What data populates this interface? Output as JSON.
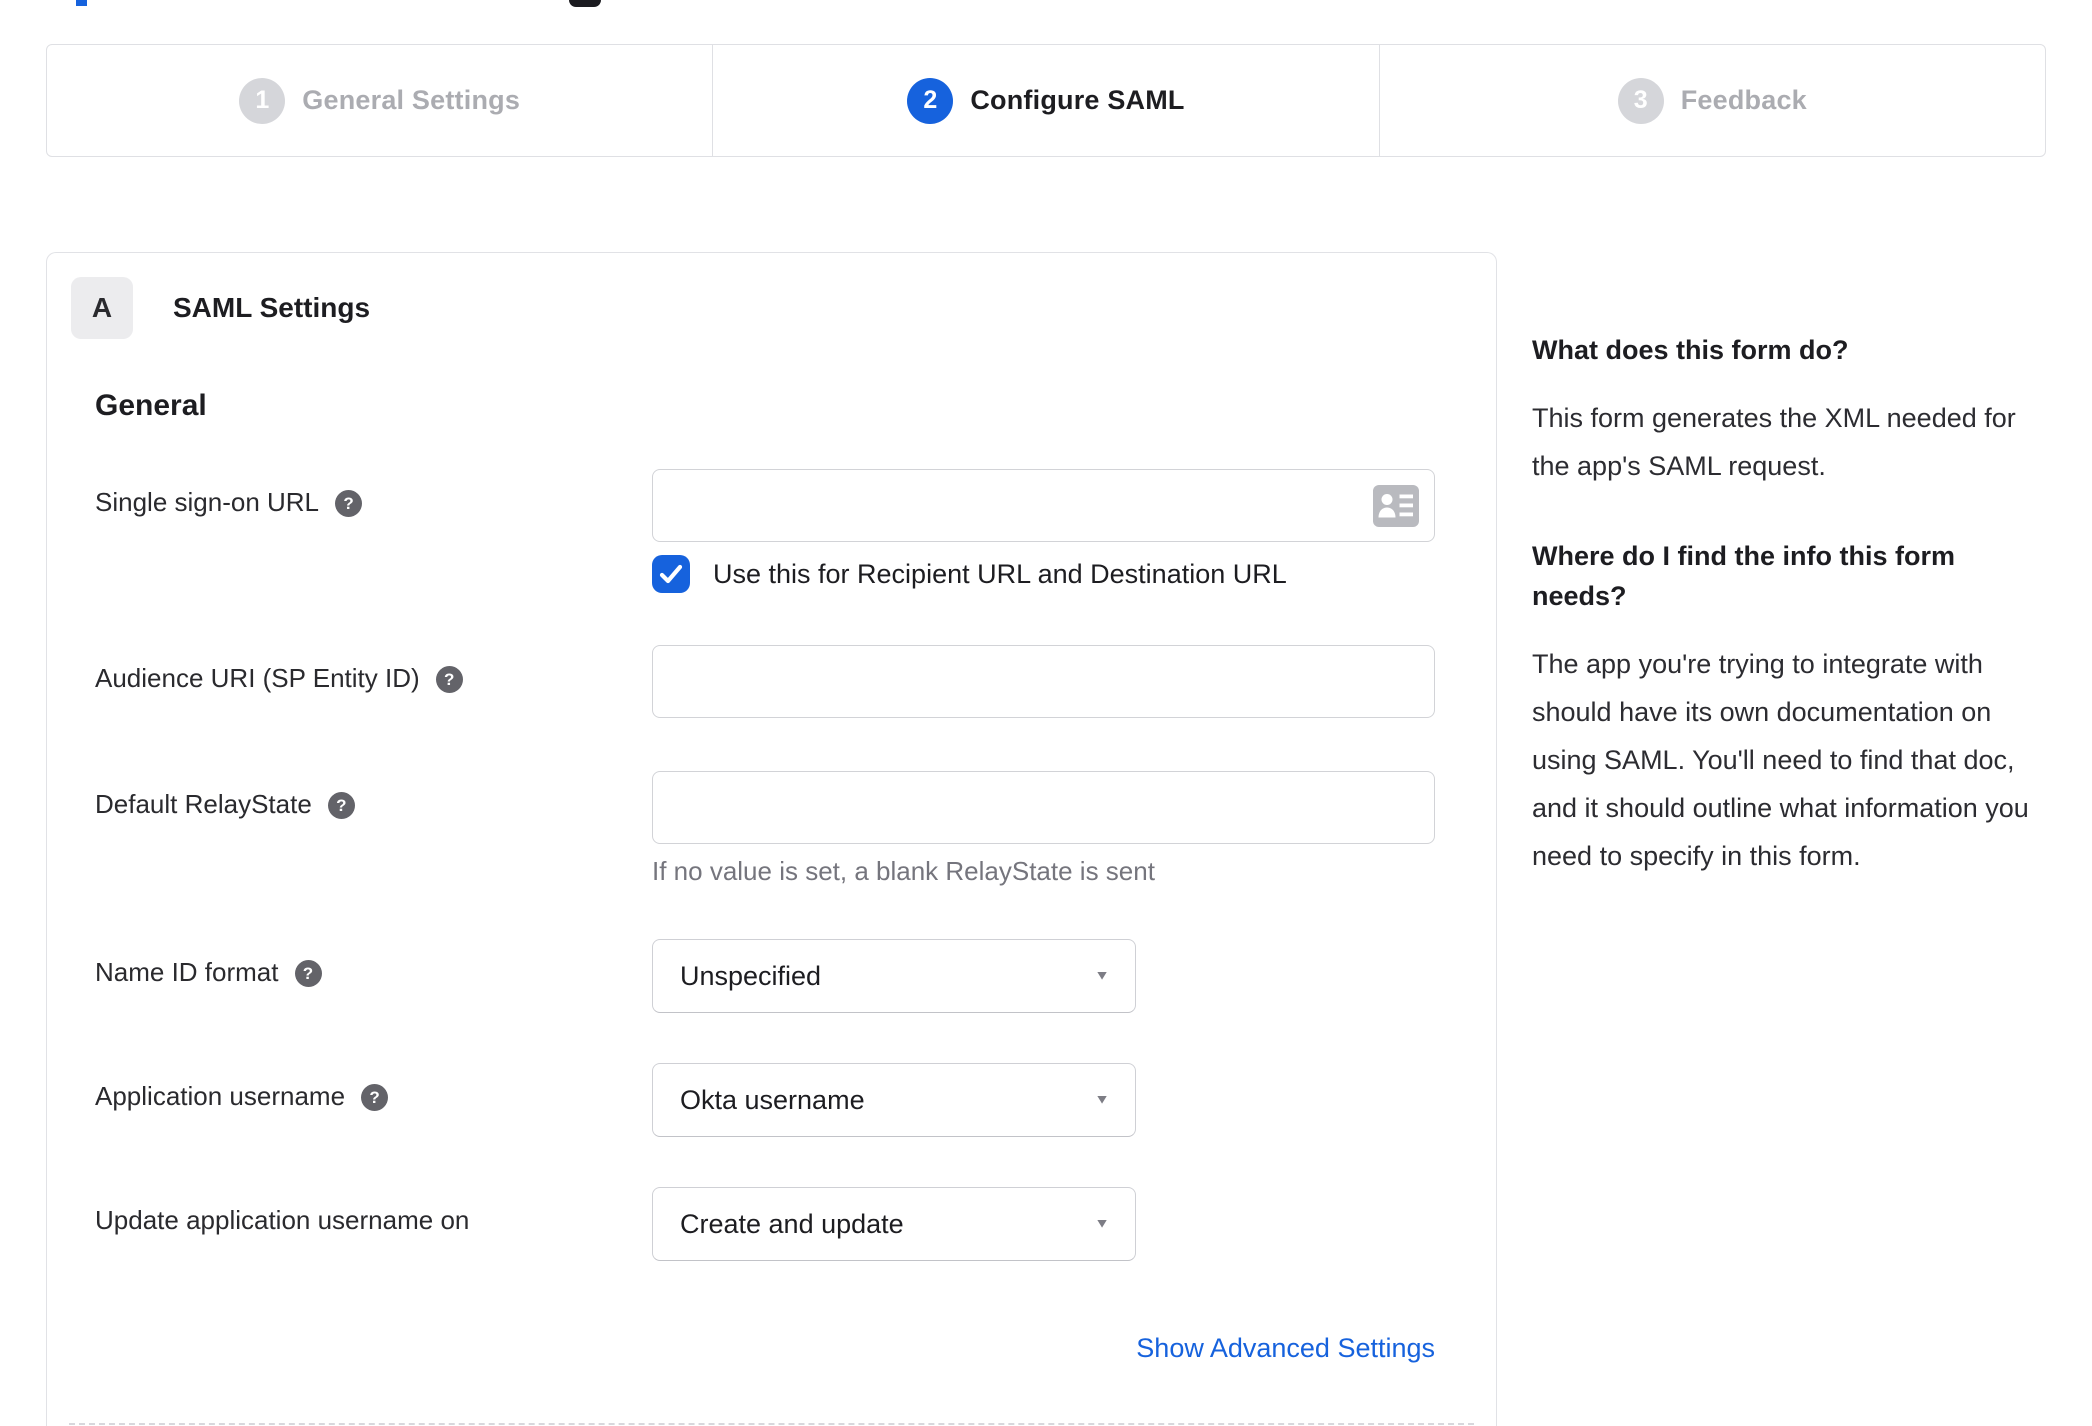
{
  "colors": {
    "accent_blue": "#1662dd",
    "inactive_step_gray": "#d5d6da",
    "inactive_step_text": "#abacb1",
    "text_dark": "#1d1d21",
    "input_border": "#d2d3d7",
    "help_icon_bg": "#636369",
    "helper_text": "#75757d"
  },
  "glyphs": {
    "help": "?",
    "caret": "▼"
  },
  "stepper": {
    "steps": [
      {
        "number": "1",
        "label": "General Settings",
        "state": "inactive"
      },
      {
        "number": "2",
        "label": "Configure SAML",
        "state": "active"
      },
      {
        "number": "3",
        "label": "Feedback",
        "state": "inactive"
      }
    ]
  },
  "saml_panel": {
    "badge": "A",
    "title": "SAML Settings",
    "group_heading": "General",
    "fields": {
      "sso": {
        "label": "Single sign-on URL",
        "value": "",
        "checkbox_checked": true,
        "checkbox_label": "Use this for Recipient URL and Destination URL"
      },
      "audience": {
        "label": "Audience URI (SP Entity ID)",
        "value": ""
      },
      "relay": {
        "label": "Default RelayState",
        "value": "",
        "helper": "If no value is set, a blank RelayState is sent"
      },
      "name_id": {
        "label": "Name ID format",
        "value": "Unspecified"
      },
      "app_username": {
        "label": "Application username",
        "value": "Okta username"
      },
      "update_username": {
        "label": "Update application username on",
        "value": "Create and update"
      }
    },
    "advanced_link": "Show Advanced Settings"
  },
  "sidebar": {
    "sections": [
      {
        "title": "What does this form do?",
        "body": "This form generates the XML needed for the app's SAML request."
      },
      {
        "title": "Where do I find the info this form needs?",
        "body": "The app you're trying to integrate with should have its own documentation on using SAML. You'll need to find that doc, and it should outline what information you need to specify in this form."
      }
    ]
  }
}
